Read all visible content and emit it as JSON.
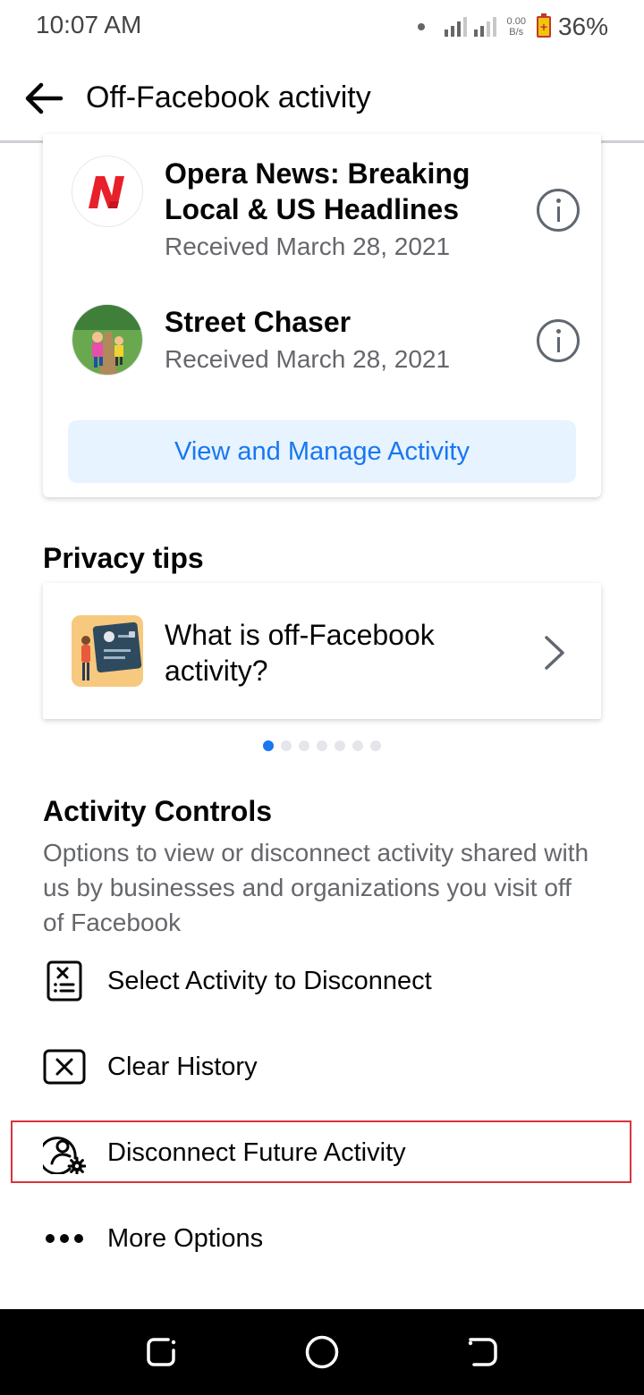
{
  "status_bar": {
    "time": "10:07 AM",
    "net_speed_value": "0.00",
    "net_speed_unit": "B/s",
    "battery_percent": "36%"
  },
  "app_bar": {
    "title": "Off-Facebook activity",
    "back_icon": "arrow-left-icon"
  },
  "activity_card": {
    "items": [
      {
        "title": "Opera News: Breaking Local & US Headlines",
        "subtitle": "Received March 28, 2021",
        "logo_icon": "opera-news-logo",
        "info_icon": "info-icon"
      },
      {
        "title": "Street Chaser",
        "subtitle": "Received March 28, 2021",
        "logo_icon": "street-chaser-logo",
        "info_icon": "info-icon"
      }
    ],
    "manage_button_label": "View and Manage Activity"
  },
  "privacy_tips": {
    "heading": "Privacy tips",
    "tip_text": "What is off-Facebook activity?",
    "carousel_total": 7,
    "carousel_active_index": 0
  },
  "activity_controls": {
    "heading": "Activity Controls",
    "description": "Options to view or disconnect activity shared with us by businesses and organizations you visit off of Facebook",
    "options": [
      {
        "label": "Select Activity to Disconnect",
        "icon": "document-x-icon"
      },
      {
        "label": "Clear History",
        "icon": "clear-box-icon"
      },
      {
        "label": "Disconnect Future Activity",
        "icon": "user-gear-icon",
        "highlighted": true
      },
      {
        "label": "More Options",
        "icon": "more-dots-icon"
      }
    ]
  },
  "colors": {
    "accent": "#1877f2",
    "accent_light_bg": "#e7f3ff",
    "secondary_text": "#65676b",
    "highlight_border": "#d9333f"
  }
}
